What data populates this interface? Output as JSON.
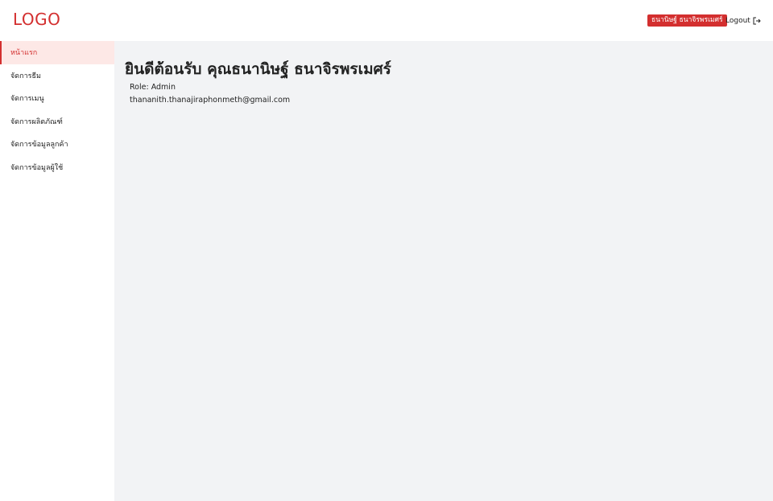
{
  "header": {
    "logo": "LOGO",
    "user_name": "ธนานิษฐ์ ธนาจิรพรเมศร์",
    "logout_label": "Logout",
    "logout_icon": "logout-icon"
  },
  "sidebar": {
    "items": [
      {
        "label": "หน้าแรก",
        "active": true
      },
      {
        "label": "จัดการธีม",
        "active": false
      },
      {
        "label": "จัดการเมนู",
        "active": false
      },
      {
        "label": "จัดการผลิตภัณฑ์",
        "active": false
      },
      {
        "label": "จัดการข้อมูลลูกค้า",
        "active": false
      },
      {
        "label": "จัดการข้อมูลผู้ใช้",
        "active": false
      }
    ]
  },
  "main": {
    "welcome": "ยินดีต้อนรับ คุณธนานิษฐ์ ธนาจิรพรเมศร์",
    "role": "Role: Admin",
    "email": "thananith.thanajiraphonmeth@gmail.com"
  },
  "colors": {
    "accent": "#d32f2f",
    "active_bg": "#fde8e6",
    "content_bg": "#f2f3f5"
  }
}
